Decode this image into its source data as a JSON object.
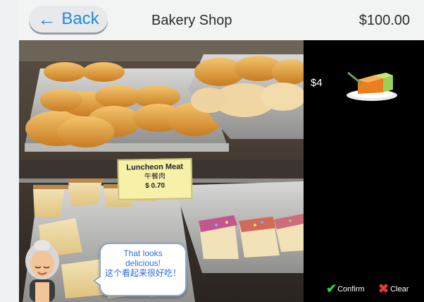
{
  "header": {
    "back_label": "Back",
    "title": "Bakery Shop",
    "balance": "$100.00"
  },
  "scene": {
    "sign": {
      "line1": "Luncheon Meat",
      "line2": "午餐肉",
      "line3": "$ 0.70"
    },
    "bubble": {
      "line1": "That looks",
      "line2": "delicious!",
      "line3": "这个看起来很好吃！"
    }
  },
  "cart": {
    "price": "$4",
    "item_icon": "layer-cake-icon"
  },
  "actions": {
    "confirm_label": "Confirm",
    "clear_label": "Clear"
  },
  "colors": {
    "accent_blue": "#1e88e5",
    "confirm_green": "#2fd04b",
    "clear_red": "#e53935"
  }
}
